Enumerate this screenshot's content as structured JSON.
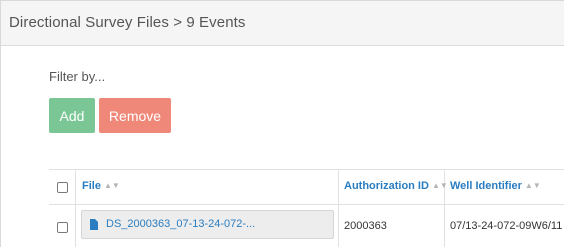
{
  "panel": {
    "title": "Directional Survey Files > 9 Events"
  },
  "filter": {
    "label": "Filter by..."
  },
  "actions": {
    "add_label": "Add",
    "remove_label": "Remove",
    "colors": {
      "add": "#7ac795",
      "remove": "#f0887a",
      "link": "#2a7dc0"
    }
  },
  "table": {
    "columns": [
      {
        "label": "File",
        "sort_icon": "sort-icon"
      },
      {
        "label": "Authorization ID",
        "sort_icon": "sort-icon"
      },
      {
        "label": "Well Identifier",
        "sort_icon": "sort-icon"
      }
    ],
    "rows": [
      {
        "file_icon": "file-icon",
        "file": "DS_2000363_07-13-24-072-...",
        "authorization_id": "2000363",
        "well_identifier": "07/13-24-072-09W6/11"
      }
    ]
  }
}
